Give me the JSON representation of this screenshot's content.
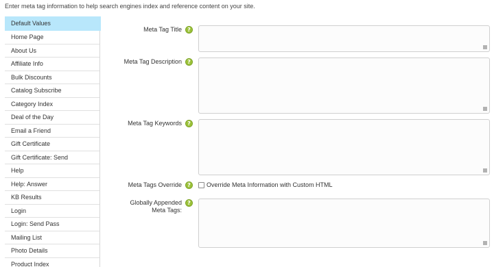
{
  "intro_text": "Enter meta tag information to help search engines index and reference content on your site.",
  "sidebar": {
    "items": [
      {
        "label": "Default Values",
        "active": true
      },
      {
        "label": "Home Page"
      },
      {
        "label": "About Us"
      },
      {
        "label": "Affiliate Info"
      },
      {
        "label": "Bulk Discounts"
      },
      {
        "label": "Catalog Subscribe"
      },
      {
        "label": "Category Index"
      },
      {
        "label": "Deal of the Day"
      },
      {
        "label": "Email a Friend"
      },
      {
        "label": "Gift Certificate"
      },
      {
        "label": "Gift Certificate: Send"
      },
      {
        "label": "Help"
      },
      {
        "label": "Help: Answer"
      },
      {
        "label": "KB Results"
      },
      {
        "label": "Login"
      },
      {
        "label": "Login: Send Pass"
      },
      {
        "label": "Mailing List"
      },
      {
        "label": "Photo Details"
      },
      {
        "label": "Product Index"
      }
    ]
  },
  "form": {
    "meta_title": {
      "label": "Meta Tag Title",
      "value": ""
    },
    "meta_description": {
      "label": "Meta Tag Description",
      "value": ""
    },
    "meta_keywords": {
      "label": "Meta Tag Keywords",
      "value": ""
    },
    "override": {
      "label": "Meta Tags Override",
      "checkbox_label": "Override Meta Information with Custom HTML",
      "checked": false
    },
    "appended": {
      "label_line1": "Globally Appended",
      "label_line2": "Meta Tags:",
      "value": ""
    },
    "help_glyph": "?"
  },
  "colors": {
    "sidebar_active": "#b8e7fb",
    "help_icon": "#9cc23a"
  }
}
